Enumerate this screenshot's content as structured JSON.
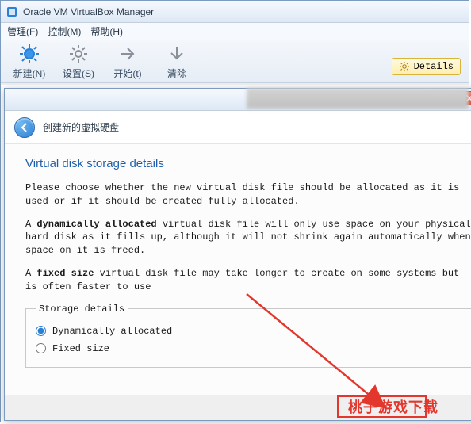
{
  "window": {
    "title": "Oracle VM VirtualBox Manager"
  },
  "menu": {
    "manage": "管理(F)",
    "control": "控制(M)",
    "help": "帮助(H)"
  },
  "toolbar": {
    "new": "新建(N)",
    "settings": "设置(S)",
    "start": "开始(t)",
    "discard": "清除",
    "details": "Details"
  },
  "dialog": {
    "breadcrumb": "创建新的虚拟硬盘",
    "page_title": "Virtual disk storage details",
    "para1": "Please choose whether the new virtual disk file should be allocated as it is used or if it should be created fully allocated.",
    "para2a": "A ",
    "para2b": "dynamically allocated",
    "para2c": " virtual disk file will only use space on your physical hard disk as it fills up, although it will not shrink again automatically when space on it is freed.",
    "para3a": "A ",
    "para3b": "fixed size",
    "para3c": " virtual disk file may take longer to create on some systems but is often faster to use",
    "fieldset_legend": "Storage details",
    "opt_dynamic": "Dynamically allocated",
    "opt_fixed": "Fixed size"
  },
  "watermark": "桃子游戏下载"
}
